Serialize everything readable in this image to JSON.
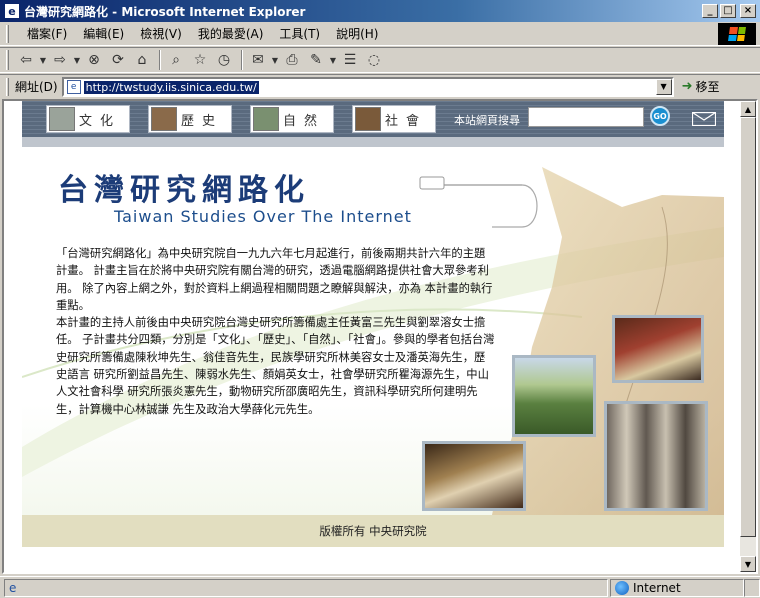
{
  "window": {
    "title": "台灣研究網路化 - Microsoft Internet Explorer",
    "controls": {
      "minimize": "_",
      "maximize": "□",
      "close": "×"
    }
  },
  "menu": {
    "items": [
      "檔案(F)",
      "編輯(E)",
      "檢視(V)",
      "我的最愛(A)",
      "工具(T)",
      "說明(H)"
    ]
  },
  "toolbar": {
    "buttons": [
      {
        "name": "back-icon",
        "glyph": "⇦"
      },
      {
        "name": "forward-icon",
        "glyph": "⇨"
      },
      {
        "name": "stop-icon",
        "glyph": "⊗"
      },
      {
        "name": "refresh-icon",
        "glyph": "⟳"
      },
      {
        "name": "home-icon",
        "glyph": "⌂"
      },
      {
        "name": "search-icon",
        "glyph": "⌕"
      },
      {
        "name": "favorites-icon",
        "glyph": "☆"
      },
      {
        "name": "history-icon",
        "glyph": "◷"
      },
      {
        "name": "mail-icon",
        "glyph": "✉"
      },
      {
        "name": "print-icon",
        "glyph": "⎙"
      },
      {
        "name": "edit-icon",
        "glyph": "✎"
      },
      {
        "name": "discuss-icon",
        "glyph": "☰"
      },
      {
        "name": "messenger-icon",
        "glyph": "◌"
      }
    ]
  },
  "address": {
    "label": "網址(D)",
    "url": "http://twstudy.iis.sinica.edu.tw/",
    "go_label": "移至"
  },
  "site": {
    "nav": {
      "tabs": [
        {
          "label": "文化",
          "thumb_color": "#9aa39a"
        },
        {
          "label": "歷史",
          "thumb_color": "#8a6a4a"
        },
        {
          "label": "自然",
          "thumb_color": "#7a9070"
        },
        {
          "label": "社會",
          "thumb_color": "#7a5a3a"
        }
      ],
      "search_label": "本站網頁搜尋",
      "go_label": "GO"
    },
    "title_zh": "台灣研究網路化",
    "title_en": "Taiwan Studies Over The Internet",
    "intro": [
      "「台灣研究網路化」為中央研究院自一九九六年七月起進行，前後兩期共計六年的主題計畫。 計畫主旨在於將中央研究院有關台灣的研究，透過電腦網路提供社會大眾參考利用。 除了內容上網之外，對於資料上網過程相關問題之瞭解與解決，亦為 本計畫的執行重點。",
      "本計畫的主持人前後由中央研究院台灣史研究所籌備處主任黃富三先生與劉翠溶女士擔任。 子計畫共分四類，分別是「文化」、「歷史」、「自然」、「社會」。參與的學者包括台灣 史研究所籌備處陳秋坤先生、翁佳音先生，民族學研究所林美容女士及潘英海先生，歷史語言 研究所劉益昌先生、陳弱水先生、顏娟英女士，社會學研究所瞿海源先生，中山人文社會科學 研究所張炎憲先生，動物研究所邵廣昭先生，資訊科學研究所何建明先生，計算機中心林誠謙 先生及政治大學薛化元先生。"
    ],
    "footer": "版權所有  中央研究院",
    "brand_colors": {
      "title": "#1c3c78",
      "nav_bg": "#5a6a7e",
      "footer_bg": "#e2dec0"
    }
  },
  "status": {
    "text": "",
    "zone": "Internet"
  }
}
